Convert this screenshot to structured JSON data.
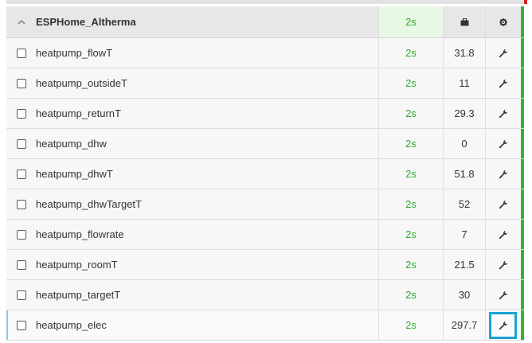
{
  "device": {
    "name": "ESPHome_Altherma",
    "age": "2s",
    "status_color": "#2fb52f",
    "expanded_icon": "chevron-up-icon",
    "value_header_icon": "briefcase-icon",
    "action_header_icon": "gear-icon"
  },
  "rows": [
    {
      "name": "heatpump_flowT",
      "age": "2s",
      "value": "31.8"
    },
    {
      "name": "heatpump_outsideT",
      "age": "2s",
      "value": "11"
    },
    {
      "name": "heatpump_returnT",
      "age": "2s",
      "value": "29.3"
    },
    {
      "name": "heatpump_dhw",
      "age": "2s",
      "value": "0"
    },
    {
      "name": "heatpump_dhwT",
      "age": "2s",
      "value": "51.8"
    },
    {
      "name": "heatpump_dhwTargetT",
      "age": "2s",
      "value": "52"
    },
    {
      "name": "heatpump_flowrate",
      "age": "2s",
      "value": "7"
    },
    {
      "name": "heatpump_roomT",
      "age": "2s",
      "value": "21.5"
    },
    {
      "name": "heatpump_targetT",
      "age": "2s",
      "value": "30"
    },
    {
      "name": "heatpump_elec",
      "age": "2s",
      "value": "297.7"
    }
  ],
  "row_action_icon": "wrench-icon",
  "colors": {
    "age_green": "#2fa82f",
    "focus_blue": "#1aa3d4",
    "alert_red": "#e02020"
  }
}
